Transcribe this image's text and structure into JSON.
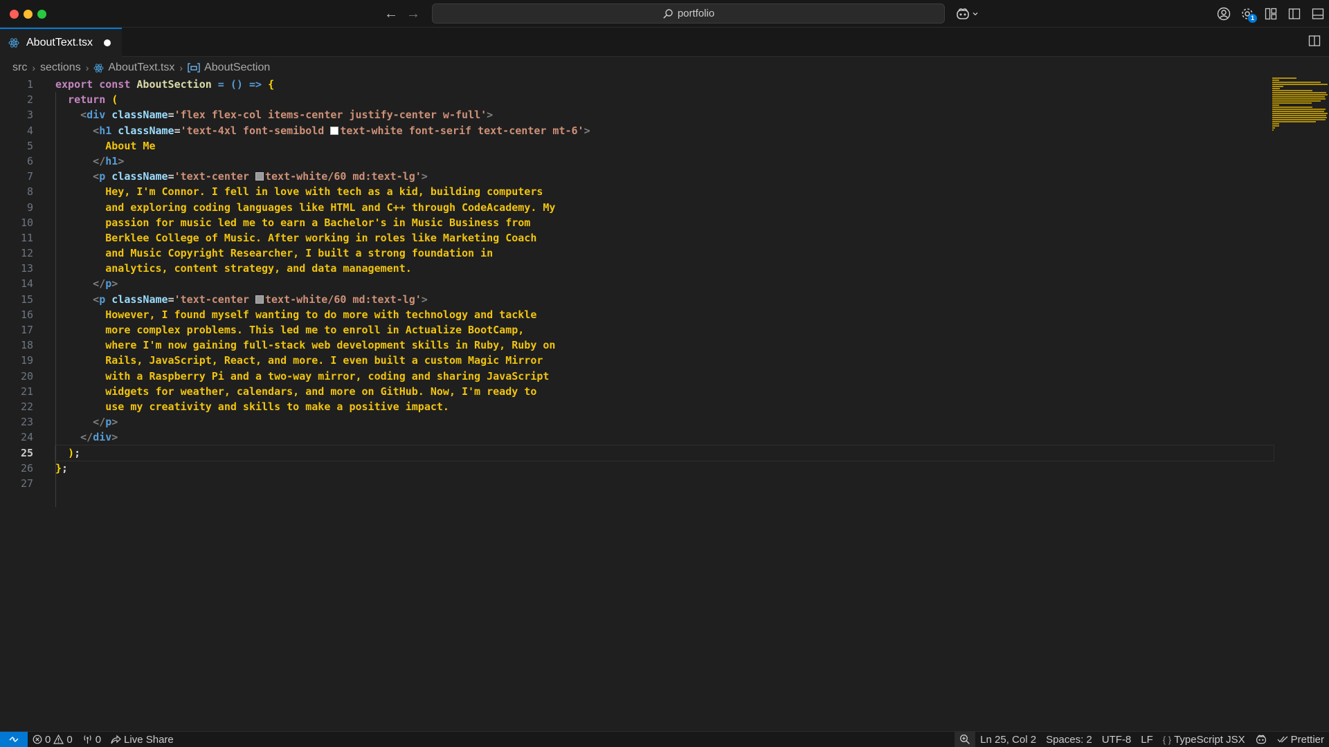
{
  "titlebar": {
    "command_center": "portfolio",
    "back_label": "←",
    "forward_label": "→",
    "settings_badge": "1"
  },
  "tab": {
    "label": "AboutText.tsx"
  },
  "breadcrumb": [
    {
      "label": "src"
    },
    {
      "label": "sections"
    },
    {
      "label": "AboutText.tsx"
    },
    {
      "label": "AboutSection"
    }
  ],
  "editor": {
    "line_numbers": [
      "1",
      "2",
      "3",
      "4",
      "5",
      "6",
      "7",
      "8",
      "9",
      "10",
      "11",
      "12",
      "13",
      "14",
      "15",
      "16",
      "17",
      "18",
      "19",
      "20",
      "21",
      "22",
      "23",
      "24",
      "25",
      "26",
      "27"
    ],
    "active_line": "25",
    "lines": [
      [
        {
          "t": "export const ",
          "c": "kw"
        },
        {
          "t": "AboutSection",
          "c": "fn"
        },
        {
          "t": " = () => ",
          "c": "kw2"
        },
        {
          "t": "{",
          "c": "yel"
        }
      ],
      [
        {
          "t": "  return ",
          "c": "kw"
        },
        {
          "t": "(",
          "c": "yel"
        }
      ],
      [
        {
          "t": "    <",
          "c": "brk"
        },
        {
          "t": "div",
          "c": "tag"
        },
        {
          "t": " className",
          "c": "attr"
        },
        {
          "t": "=",
          "c": "pun"
        },
        {
          "t": "'flex flex-col items-center justify-center w-full'",
          "c": "str"
        },
        {
          "t": ">",
          "c": "brk"
        }
      ],
      [
        {
          "t": "      <",
          "c": "brk"
        },
        {
          "t": "h1",
          "c": "tag"
        },
        {
          "t": " className",
          "c": "attr"
        },
        {
          "t": "=",
          "c": "pun"
        },
        {
          "t": "'text-4xl font-semibold ",
          "c": "str"
        },
        {
          "t": "",
          "c": "swatch-white"
        },
        {
          "t": "text-white font-serif text-center mt-6'",
          "c": "str"
        },
        {
          "t": ">",
          "c": "brk"
        }
      ],
      [
        {
          "t": "        About Me",
          "c": "txt"
        }
      ],
      [
        {
          "t": "      </",
          "c": "brk"
        },
        {
          "t": "h1",
          "c": "tag"
        },
        {
          "t": ">",
          "c": "brk"
        }
      ],
      [
        {
          "t": "      <",
          "c": "brk"
        },
        {
          "t": "p",
          "c": "tag"
        },
        {
          "t": " className",
          "c": "attr"
        },
        {
          "t": "=",
          "c": "pun"
        },
        {
          "t": "'text-center ",
          "c": "str"
        },
        {
          "t": "",
          "c": "swatch-grey"
        },
        {
          "t": "text-white/60 md:text-lg'",
          "c": "str"
        },
        {
          "t": ">",
          "c": "brk"
        }
      ],
      [
        {
          "t": "        Hey, I'm Connor. I fell in love with tech as a kid, building computers",
          "c": "txt"
        }
      ],
      [
        {
          "t": "        and exploring coding languages like HTML and C++ through CodeAcademy. My",
          "c": "txt"
        }
      ],
      [
        {
          "t": "        passion for music led me to earn a Bachelor's in Music Business from",
          "c": "txt"
        }
      ],
      [
        {
          "t": "        Berklee College of Music. After working in roles like Marketing Coach",
          "c": "txt"
        }
      ],
      [
        {
          "t": "        and Music Copyright Researcher, I built a strong foundation in",
          "c": "txt"
        }
      ],
      [
        {
          "t": "        analytics, content strategy, and data management.",
          "c": "txt"
        }
      ],
      [
        {
          "t": "      </",
          "c": "brk"
        },
        {
          "t": "p",
          "c": "tag"
        },
        {
          "t": ">",
          "c": "brk"
        }
      ],
      [
        {
          "t": "      <",
          "c": "brk"
        },
        {
          "t": "p",
          "c": "tag"
        },
        {
          "t": " className",
          "c": "attr"
        },
        {
          "t": "=",
          "c": "pun"
        },
        {
          "t": "'text-center ",
          "c": "str"
        },
        {
          "t": "",
          "c": "swatch-grey"
        },
        {
          "t": "text-white/60 md:text-lg'",
          "c": "str"
        },
        {
          "t": ">",
          "c": "brk"
        }
      ],
      [
        {
          "t": "        However, I found myself wanting to do more with technology and tackle",
          "c": "txt"
        }
      ],
      [
        {
          "t": "        more complex problems. This led me to enroll in Actualize BootCamp,",
          "c": "txt"
        }
      ],
      [
        {
          "t": "        where I'm now gaining full-stack web development skills in Ruby, Ruby on",
          "c": "txt"
        }
      ],
      [
        {
          "t": "        Rails, JavaScript, React, and more. I even built a custom Magic Mirror",
          "c": "txt"
        }
      ],
      [
        {
          "t": "        with a Raspberry Pi and a two-way mirror, coding and sharing JavaScript",
          "c": "txt"
        }
      ],
      [
        {
          "t": "        widgets for weather, calendars, and more on GitHub. Now, I'm ready to",
          "c": "txt"
        }
      ],
      [
        {
          "t": "        use my creativity and skills to make a positive impact.",
          "c": "txt"
        }
      ],
      [
        {
          "t": "      </",
          "c": "brk"
        },
        {
          "t": "p",
          "c": "tag"
        },
        {
          "t": ">",
          "c": "brk"
        }
      ],
      [
        {
          "t": "    </",
          "c": "brk"
        },
        {
          "t": "div",
          "c": "tag"
        },
        {
          "t": ">",
          "c": "brk"
        }
      ],
      [
        {
          "t": "  ",
          "c": "pun"
        },
        {
          "t": ")",
          "c": "yel"
        },
        {
          "t": ";",
          "c": "pun"
        }
      ],
      [
        {
          "t": "}",
          "c": "yel"
        },
        {
          "t": ";",
          "c": "pun"
        }
      ],
      [
        {
          "t": "",
          "c": "pun"
        }
      ]
    ]
  },
  "statusbar": {
    "errors": "0",
    "warnings": "0",
    "ports": "0",
    "live_share": "Live Share",
    "cursor": "Ln 25, Col 2",
    "spaces": "Spaces: 2",
    "encoding": "UTF-8",
    "eol": "LF",
    "language": "TypeScript JSX",
    "prettier": "Prettier"
  },
  "colors": {
    "accent": "#0078d4",
    "text_yellow": "#f1c40f",
    "keyword": "#c586c0",
    "tag": "#569cd6",
    "string": "#ce9178"
  }
}
